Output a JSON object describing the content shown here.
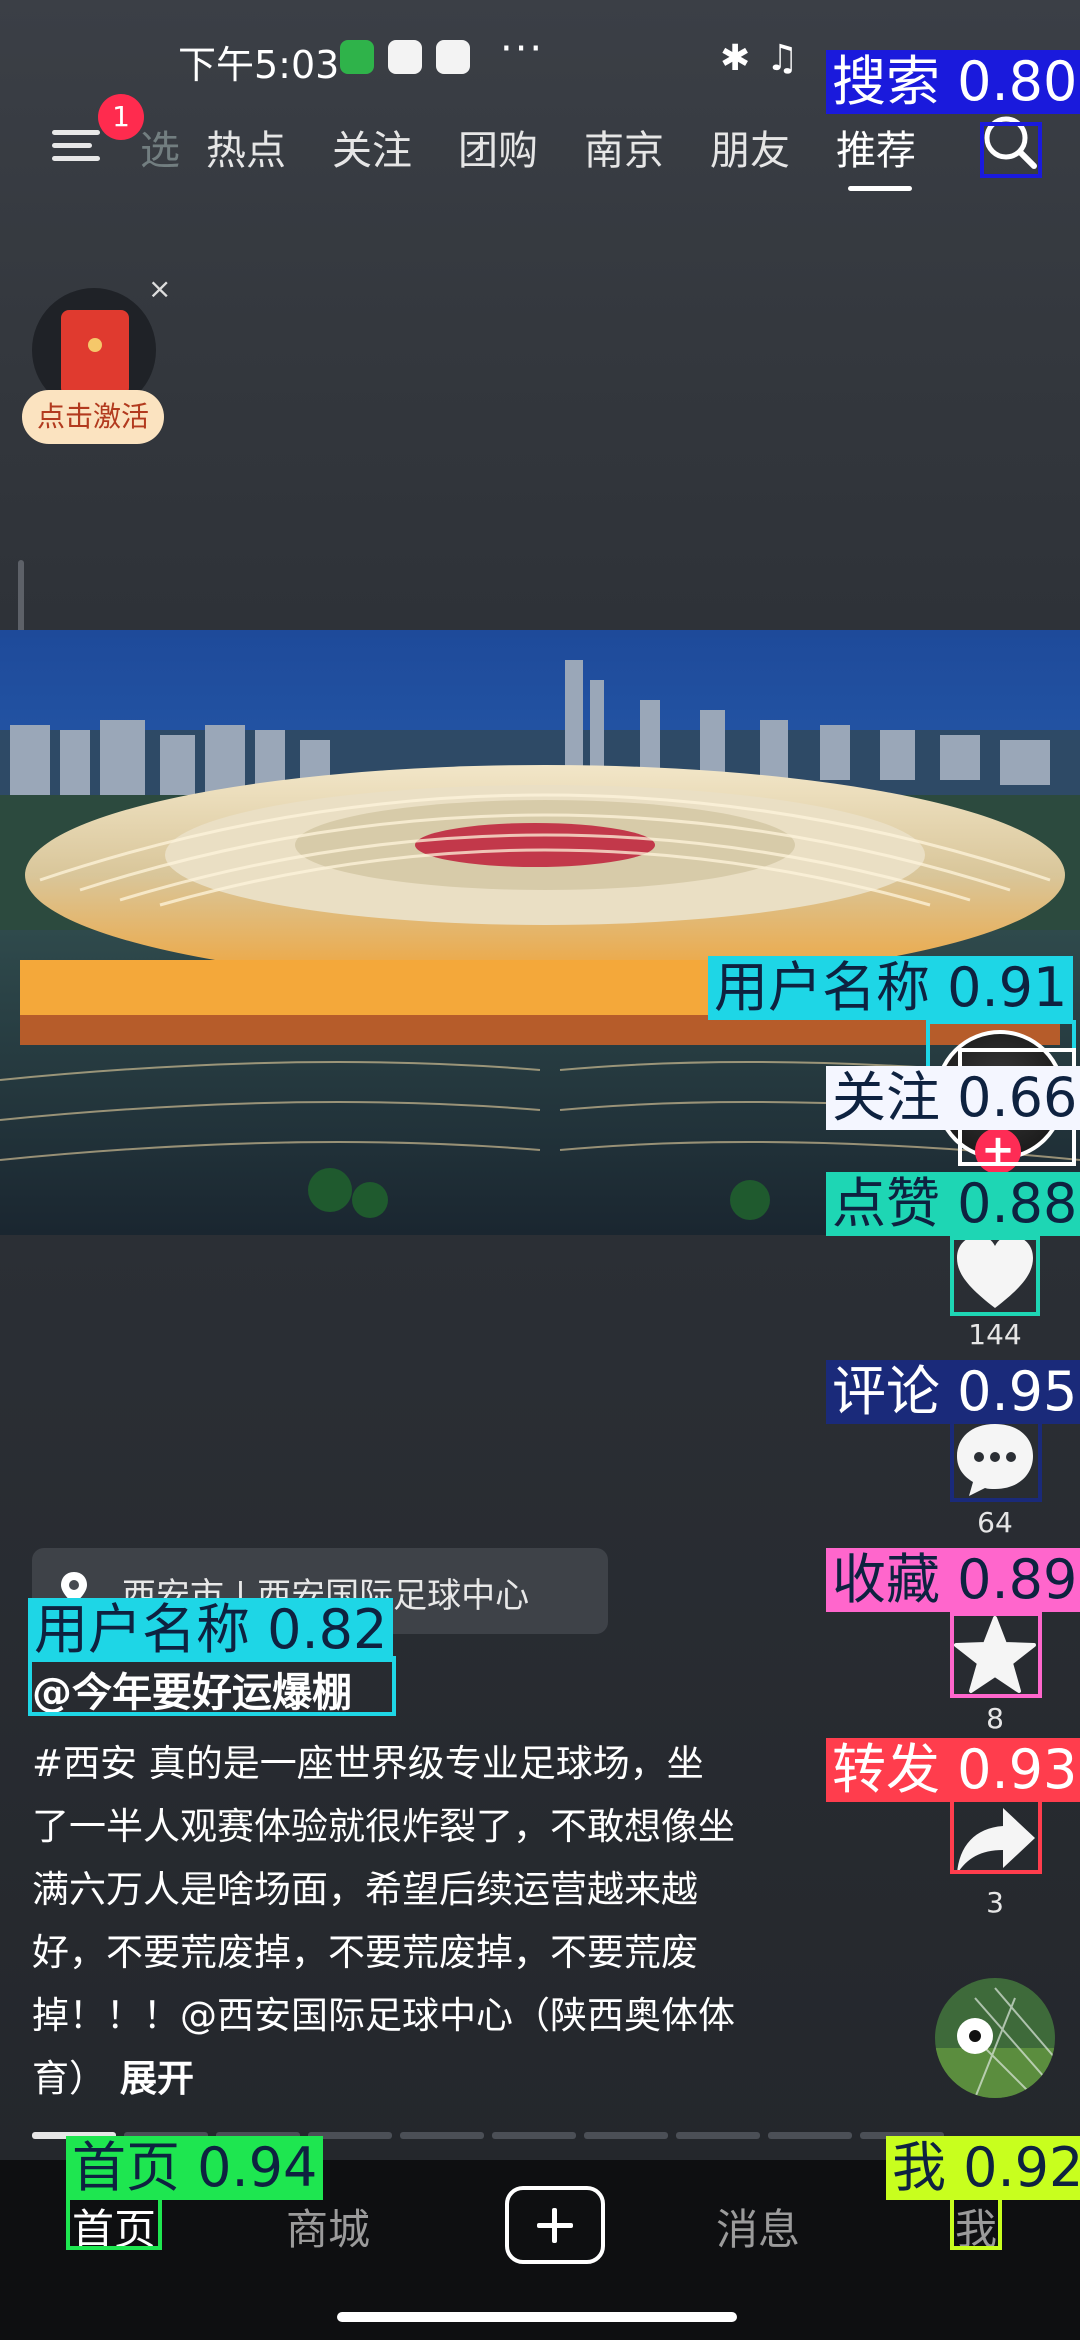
{
  "status_bar": {
    "time": "下午5:03",
    "more": "···"
  },
  "top_nav": {
    "badge_count": "1",
    "tabs": [
      "选",
      "热点",
      "关注",
      "团购",
      "南京",
      "朋友",
      "推荐"
    ],
    "active_tab": "推荐"
  },
  "red_packet": {
    "label": "点击激活",
    "close": "×"
  },
  "actions": {
    "like_count": "144",
    "comment_count": "64",
    "favorite_count": "8",
    "share_count": "3"
  },
  "caption": {
    "location": "西安市 | 西安国际足球中心",
    "author": "@今年要好运爆棚",
    "lines": [
      "#西安 真的是一座世界级专业足球场，坐",
      "了一半人观赛体验就很炸裂了，不敢想像坐",
      "满六万人是啥场面，希望后续运营越来越",
      "好，不要荒废掉，不要荒废掉，不要荒废",
      "掉！！！@西安国际足球中心（陕西奥体体",
      "育）"
    ],
    "expand": "展开"
  },
  "bottom_nav": {
    "home": "首页",
    "mall": "商城",
    "messages": "消息",
    "me": "我"
  },
  "detections": {
    "search": "搜索 0.80",
    "username_right": "用户名称 0.91",
    "follow": "关注 0.66",
    "like": "点赞 0.88",
    "comment": "评论 0.95",
    "favorite": "收藏 0.89",
    "share": "转发 0.93",
    "username_left": "用户名称 0.82",
    "home": "首页 0.94",
    "me": "我 0.92"
  },
  "colors": {
    "search": "#1a1adc",
    "username": "#1ed6e6",
    "follow": "#ffffff",
    "like": "#1ed6b4",
    "comment": "#1a2a7a",
    "favorite": "#ff66cc",
    "share": "#ff3d4d",
    "home": "#1ee650",
    "me": "#c8ff1e"
  }
}
